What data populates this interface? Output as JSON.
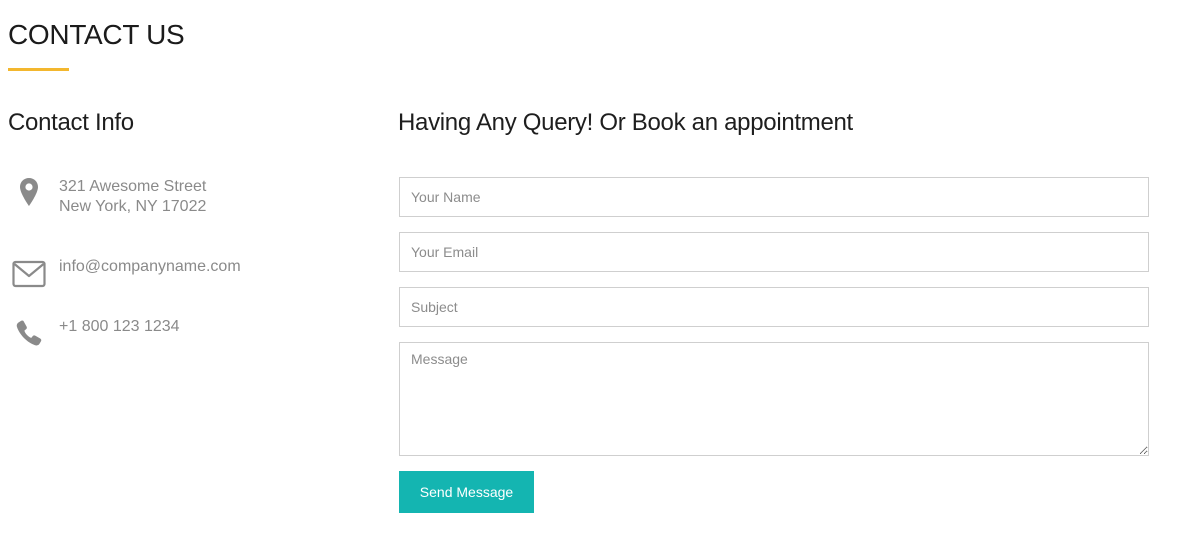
{
  "section": {
    "title": "CONTACT US",
    "accent_color": "#f3b72e"
  },
  "contact_info": {
    "heading": "Contact Info",
    "address_line1": "321 Awesome Street",
    "address_line2": "New York, NY 17022",
    "email": "info@companyname.com",
    "phone": "+1 800 123 1234",
    "icons": [
      "map-marker-icon",
      "envelope-icon",
      "phone-icon"
    ],
    "icon_color": "#8a8a8a"
  },
  "form": {
    "heading": "Having Any Query! Or Book an appointment",
    "name_placeholder": "Your Name",
    "email_placeholder": "Your Email",
    "subject_placeholder": "Subject",
    "message_placeholder": "Message",
    "submit_label": "Send Message",
    "button_color": "#14b5b1"
  }
}
